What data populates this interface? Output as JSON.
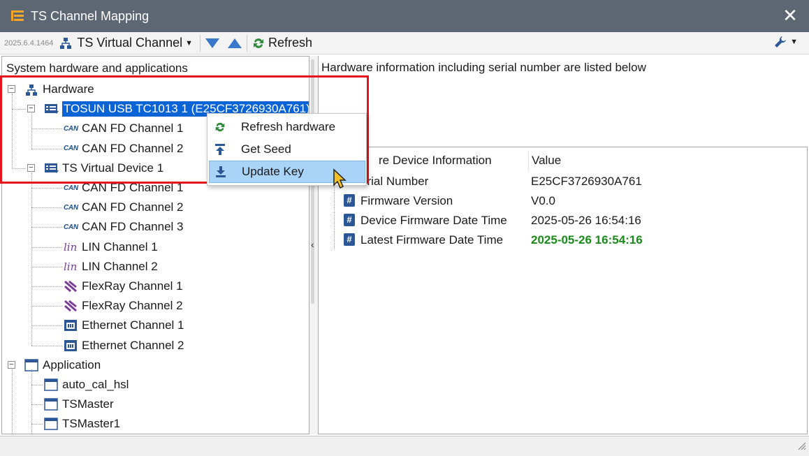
{
  "window": {
    "title": "TS Channel Mapping"
  },
  "toolbar": {
    "version": "2025.6.4.1464",
    "channel_select": "TS Virtual Channel",
    "refresh_label": "Refresh"
  },
  "left_panel": {
    "title": "System hardware and applications",
    "hardware_label": "Hardware",
    "device1": {
      "label": "TOSUN USB TC1013 1 (E25CF3726930A761)",
      "channels": [
        "CAN FD Channel 1",
        "CAN FD Channel 2"
      ]
    },
    "device2": {
      "label": "TS Virtual Device 1",
      "channels": [
        {
          "type": "can",
          "label": "CAN FD Channel 1"
        },
        {
          "type": "can",
          "label": "CAN FD Channel 2"
        },
        {
          "type": "can",
          "label": "CAN FD Channel 3"
        },
        {
          "type": "lin",
          "label": "LIN Channel 1"
        },
        {
          "type": "lin",
          "label": "LIN Channel 2"
        },
        {
          "type": "flexray",
          "label": "FlexRay Channel 1"
        },
        {
          "type": "flexray",
          "label": "FlexRay Channel 2"
        },
        {
          "type": "ethernet",
          "label": "Ethernet Channel 1"
        },
        {
          "type": "ethernet",
          "label": "Ethernet Channel 2"
        }
      ]
    },
    "application_label": "Application",
    "applications": [
      "auto_cal_hsl",
      "TSMaster",
      "TSMaster1"
    ],
    "can_badge": "CAN",
    "lin_badge": "lin"
  },
  "right_panel": {
    "info_text": "Hardware information including serial number are listed below",
    "col_name": "re Device Information",
    "col_value": "Value",
    "rows": [
      {
        "name": "erial Number",
        "value": "E25CF3726930A761",
        "highlight": false
      },
      {
        "name": "Firmware Version",
        "value": "V0.0",
        "highlight": false
      },
      {
        "name": "Device Firmware Date Time",
        "value": "2025-05-26 16:54:16",
        "highlight": false
      },
      {
        "name": "Latest Firmware Date Time",
        "value": "2025-05-26 16:54:16",
        "highlight": true
      }
    ],
    "highlight_color": "#1a8a1a"
  },
  "context_menu": {
    "items": [
      {
        "label": "Refresh hardware",
        "icon": "refresh-icon"
      },
      {
        "label": "Get Seed",
        "icon": "upload-icon"
      },
      {
        "label": "Update Key",
        "icon": "download-icon"
      }
    ]
  },
  "colors": {
    "titlebar": "#5c6773",
    "selection": "#0a64d6",
    "highlight_border": "#e8141c",
    "menu_active": "#a9d3f7"
  }
}
